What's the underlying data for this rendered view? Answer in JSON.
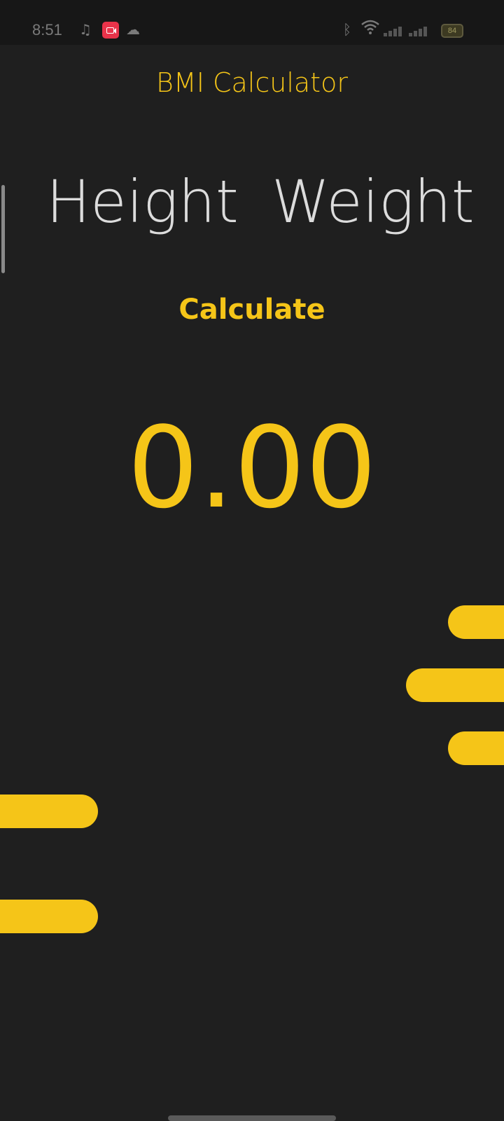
{
  "status_bar": {
    "time": "8:51",
    "battery": "84"
  },
  "app": {
    "title": "BMI Calculator",
    "height_label": "Height",
    "weight_label": "Weight",
    "calculate_label": "Calculate",
    "result": "0.00"
  },
  "colors": {
    "accent": "#f5c518",
    "background": "#1f1f1f",
    "label": "#dcdcdc"
  },
  "icons": {
    "music": "music-note-icon",
    "record": "screen-record-icon",
    "cloud": "cloud-icon",
    "bluetooth": "bluetooth-icon",
    "wifi": "wifi-icon",
    "signal": "signal-icon",
    "battery": "battery-icon"
  }
}
